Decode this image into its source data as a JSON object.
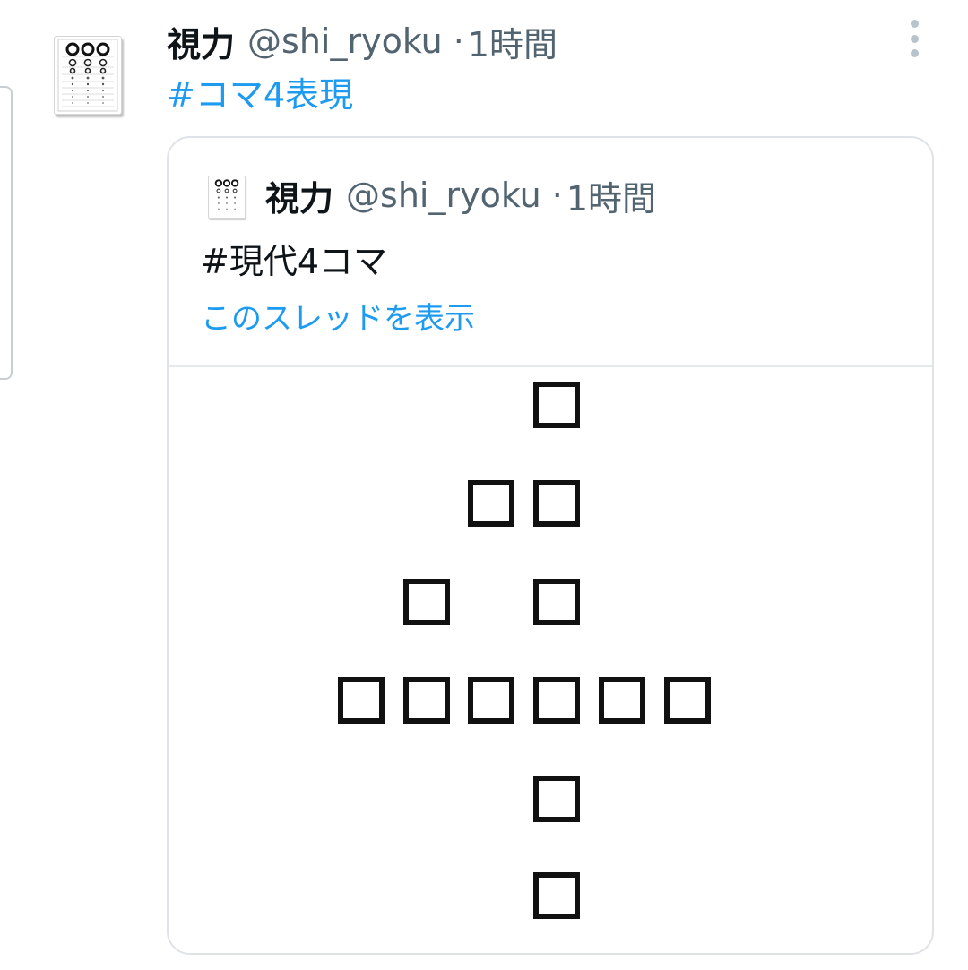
{
  "tweet": {
    "author_name": "視力",
    "handle": "@shi_ryoku",
    "timestamp": "1時間",
    "separator": "·",
    "text": "#コマ4表現"
  },
  "quoted_tweet": {
    "author_name": "視力",
    "handle": "@shi_ryoku",
    "timestamp": "1時間",
    "separator": "·",
    "text": "#現代4コマ",
    "show_thread_label": "このスレッドを表示"
  },
  "colors": {
    "link": "#1d9bf0",
    "secondary_text": "#536471",
    "border": "#dfe3e7"
  },
  "icons": {
    "more": "more-vertical-icon",
    "avatar": "eye-chart-avatar"
  }
}
